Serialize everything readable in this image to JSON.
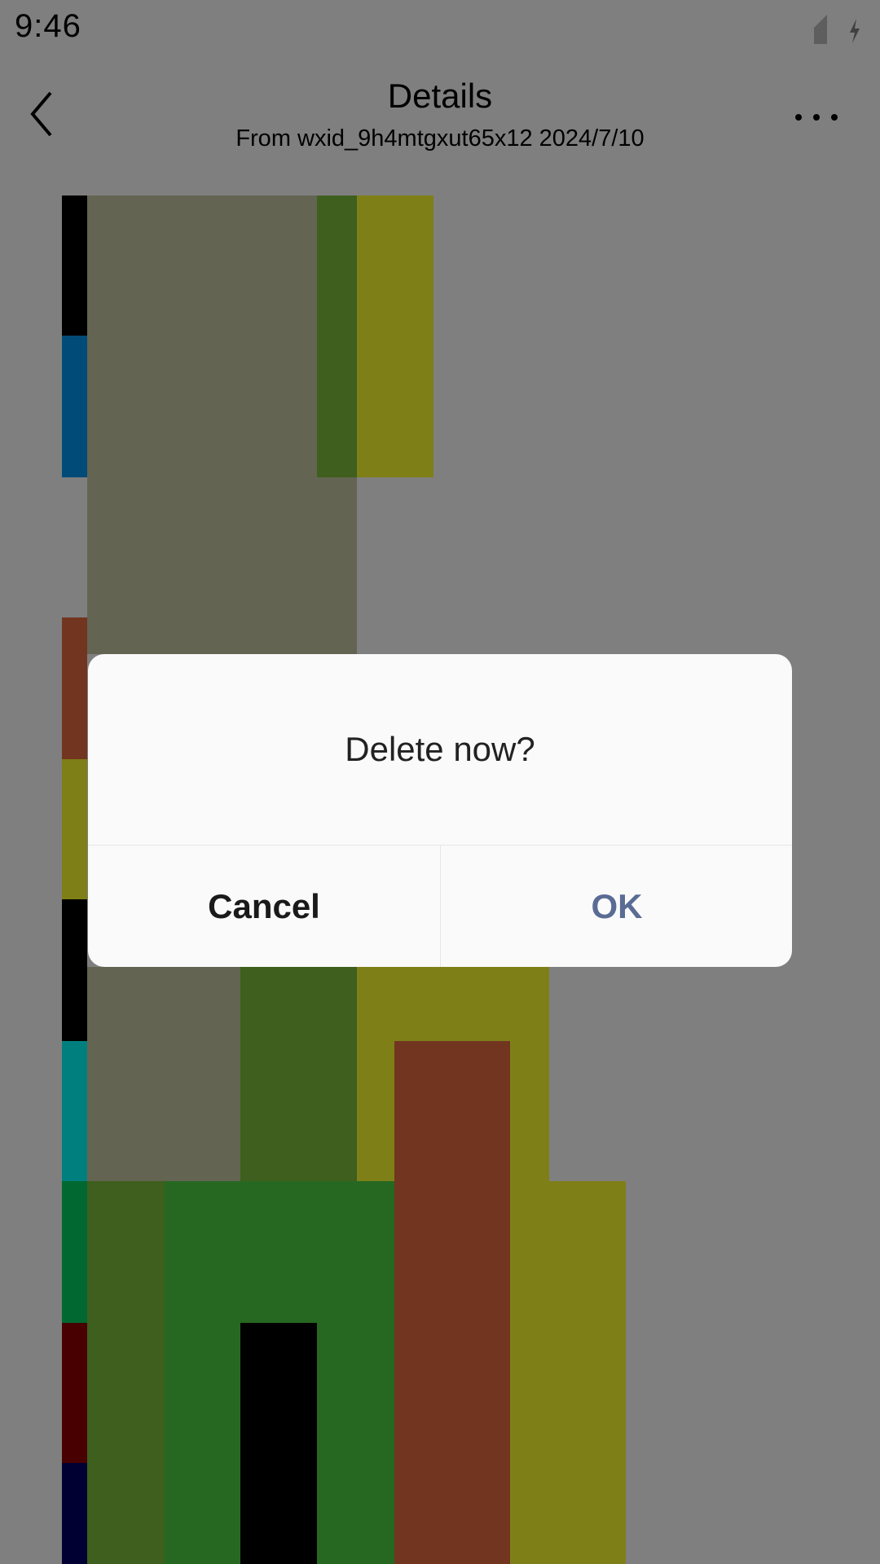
{
  "status_bar": {
    "time": "9:46",
    "icons": [
      "notification-square-icon",
      "wifi-icon",
      "signal-icon",
      "battery-charging-icon"
    ]
  },
  "header": {
    "title": "Details",
    "subtitle": "From wxid_9h4mtgxut65x12 2024/7/10",
    "back_icon": "chevron-left-icon",
    "more_icon": "more-horizontal-icon"
  },
  "dialog": {
    "message": "Delete now?",
    "cancel_label": "Cancel",
    "ok_label": "OK"
  },
  "colors": {
    "scrim": "rgba(0,0,0,0.5)",
    "dialog_background": "#fafafa",
    "ok_text": "#5a6b94",
    "cancel_text": "#1a1a1a",
    "image_tan": "#c8c9a4",
    "image_olive_dark": "#3f5f1e",
    "image_olive": "#fffe30",
    "image_brown": "#e56a40",
    "image_green": "#4dd043",
    "image_teal": "#00ffff",
    "image_navy": "#003066",
    "image_blue": "#00a0ff"
  }
}
